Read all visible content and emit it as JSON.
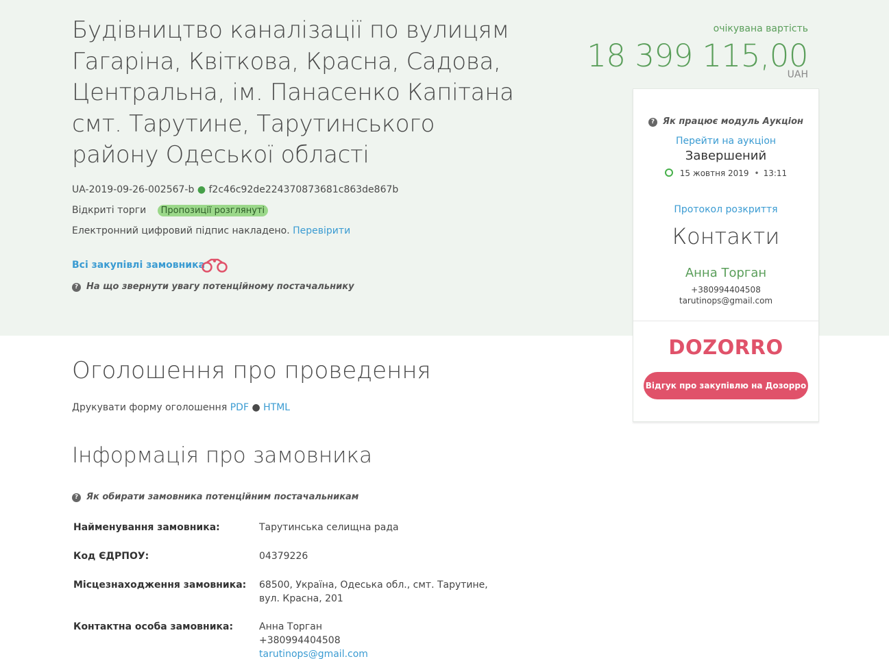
{
  "tender": {
    "title": "Будівництво каналізації по вулицям Гагаріна, Квіткова, Красна, Садова, Центральна, ім. Панасенко Капітана смт. Тарутине, Тарутинського району Одеської області",
    "id": "UA-2019-09-26-002567-b",
    "hash": "f2c46c92de224370873681c863de867b",
    "procedure": "Відкриті торги",
    "status_badge": "Пропозиції розглянуті",
    "signature_text": "Електронний цифровий підпис накладено.",
    "signature_link": "Перевірити",
    "all_purchases_link": "Всі закупівлі замовника",
    "supplier_hint": "На що звернути увагу потенційному постачальнику"
  },
  "price": {
    "label": "очікувана вартість",
    "value": "18 399 115,00",
    "currency": "UAH"
  },
  "auction_card": {
    "hint": "Як працює модуль Аукціон",
    "go_link": "Перейти на аукціон",
    "status": "Завершений",
    "date": "15 жовтня 2019",
    "time": "13:11",
    "protocol_link": "Протокол розкриття",
    "contacts_title": "Контакти",
    "contact_name": "Анна Торган",
    "contact_phone": "+380994404508",
    "contact_email": "tarutinops@gmail.com",
    "logo": "DOZORRO",
    "feedback_button": "Відгук про закупівлю на Дозорро"
  },
  "announcement": {
    "title": "Оголошення про проведення",
    "print_label": "Друкувати форму оголошення",
    "pdf_link": "PDF",
    "html_link": "HTML"
  },
  "customer": {
    "title": "Інформація про замовника",
    "hint": "Як обирати замовника потенційним постачальникам",
    "rows": [
      {
        "key": "Найменування замовника:",
        "value": "Тарутинська селищна рада"
      },
      {
        "key": "Код ЄДРПОУ:",
        "value": "04379226"
      },
      {
        "key": "Місцезнаходження замовника:",
        "value": "68500, Україна, Одеська обл., смт. Тарутине, вул. Красна, 201"
      },
      {
        "key": "Контактна особа замовника:",
        "value_name": "Анна Торган",
        "value_phone": "+380994404508",
        "value_email": "tarutinops@gmail.com"
      }
    ]
  },
  "colors": {
    "hero_bg": "#eff4ef",
    "green": "#5a9e5a",
    "link": "#3a9bd2",
    "dozorro": "#e0526a",
    "badge": "#9bd88a"
  }
}
